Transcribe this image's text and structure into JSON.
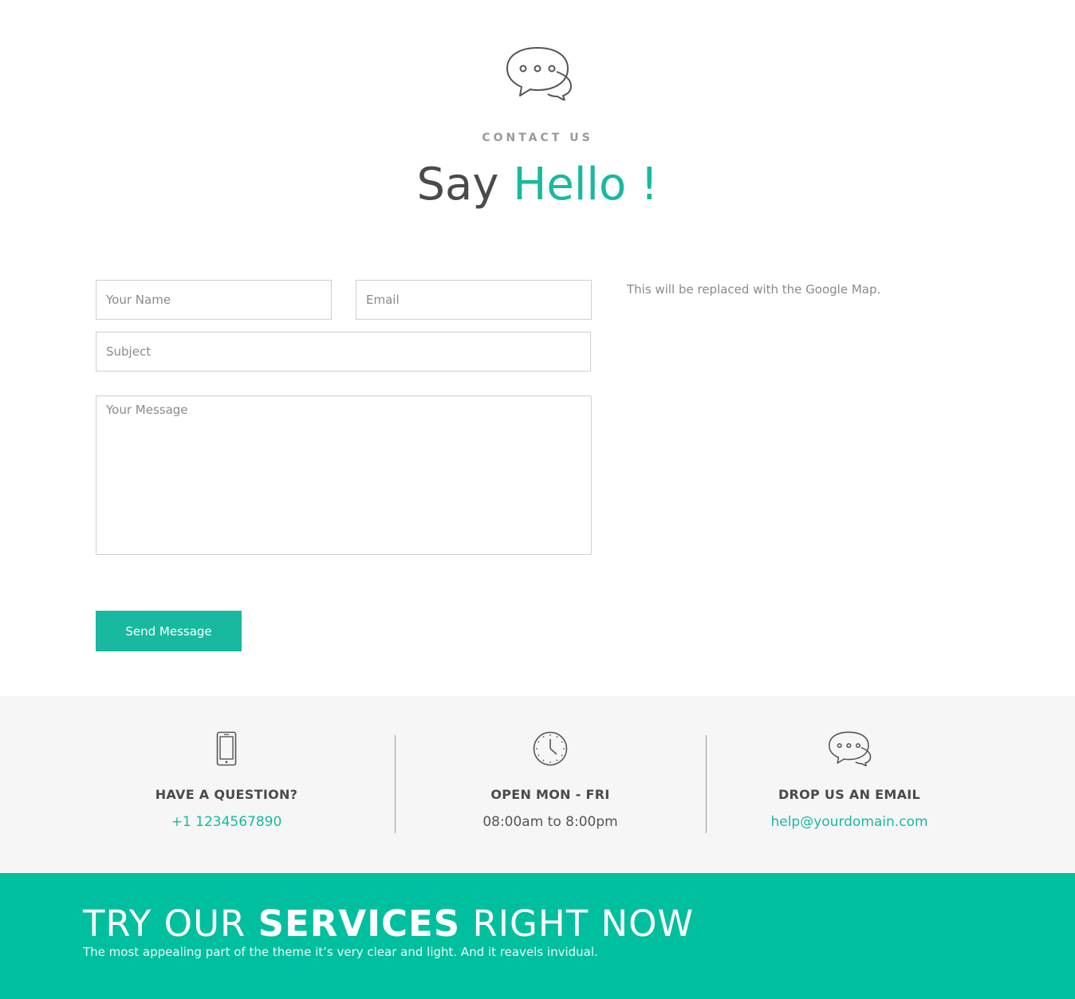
{
  "contact": {
    "eyebrow": "CONTACT US",
    "headline_plain": "Say ",
    "headline_accent": "Hello !",
    "form": {
      "name_placeholder": "Your Name",
      "email_placeholder": "Email",
      "subject_placeholder": "Subject",
      "message_placeholder": "Your Message",
      "submit_label": "Send Message"
    },
    "map_note": "This will be replaced with the Google Map."
  },
  "info": [
    {
      "icon": "mobile-phone-icon",
      "title": "HAVE A QUESTION?",
      "value": "+1 1234567890"
    },
    {
      "icon": "clock-icon",
      "title": "OPEN MON - FRI",
      "value": "08:00am to 8:00pm"
    },
    {
      "icon": "chat-bubbles-icon",
      "title": "DROP US AN EMAIL",
      "value": "help@yourdomain.com"
    }
  ],
  "cta": {
    "title_pre": "TRY OUR ",
    "title_bold": "SERVICES",
    "title_post": " RIGHT NOW",
    "subtitle": "The most appealing part of the theme it’s very clear and light. And it reavels invidual."
  },
  "colors": {
    "accent": "#18b99f",
    "cta_background": "#00bf9e",
    "info_background": "#f6f6f6"
  }
}
